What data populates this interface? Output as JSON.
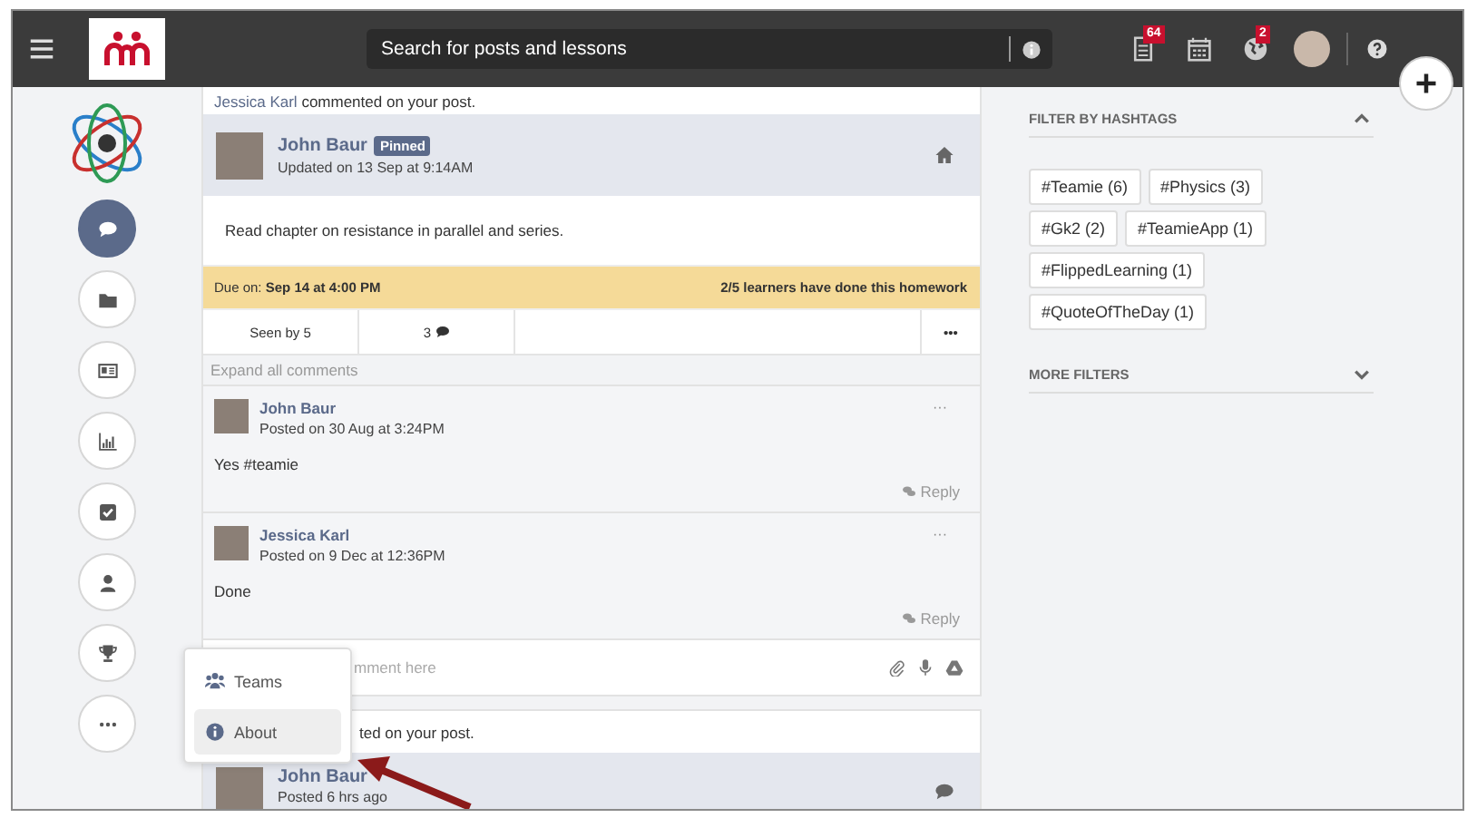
{
  "topbar": {
    "search_placeholder": "Search for posts and lessons",
    "document_count": "64",
    "globe_count": "2"
  },
  "rail": [
    {
      "selected": true
    },
    {
      "selected": false
    },
    {
      "selected": false
    },
    {
      "selected": false
    },
    {
      "selected": false
    },
    {
      "selected": false
    },
    {
      "selected": false
    },
    {
      "selected": false
    }
  ],
  "menu": [
    {
      "label": "Teams",
      "selected": false
    },
    {
      "label": "About",
      "selected": true
    }
  ],
  "posts": [
    {
      "notice": {
        "actor": "Jessica Karl",
        "text": "commented on your post."
      },
      "author": "John Baur",
      "badge": "Pinned",
      "meta": "Updated on 13 Sep at 9:14AM",
      "body": "Read chapter on resistance in parallel and series.",
      "due": {
        "label": "Due on:",
        "date": "Sep 14 at 4:00 PM",
        "progress": "2/5 learners have done this homework"
      },
      "stats": {
        "seen": "Seen by 5",
        "comments": "3",
        "more": "•••"
      },
      "expand": "Expand all comments",
      "comments": [
        {
          "author": "John Baur",
          "meta": "Posted on 30 Aug at 3:24PM",
          "text": "Yes #teamie",
          "more": "···",
          "reply": "Reply"
        },
        {
          "author": "Jessica Karl",
          "meta": "Posted on 9 Dec at 12:36PM",
          "text": "Done",
          "more": "···",
          "reply": "Reply"
        }
      ],
      "comment_placeholder": "mment here"
    },
    {
      "notice": {
        "text": "ted on your post."
      },
      "author": "John Baur",
      "meta": "Posted 6 hrs ago"
    }
  ],
  "filters": [
    {
      "title": "FILTER BY HASHTAGS",
      "expanded": true,
      "tags": [
        "#Teamie (6)",
        "#Physics (3)",
        "#Gk2 (2)",
        "#TeamieApp (1)",
        "#FlippedLearning (1)",
        "#QuoteOfTheDay (1)"
      ]
    },
    {
      "title": "MORE FILTERS",
      "expanded": false
    }
  ]
}
